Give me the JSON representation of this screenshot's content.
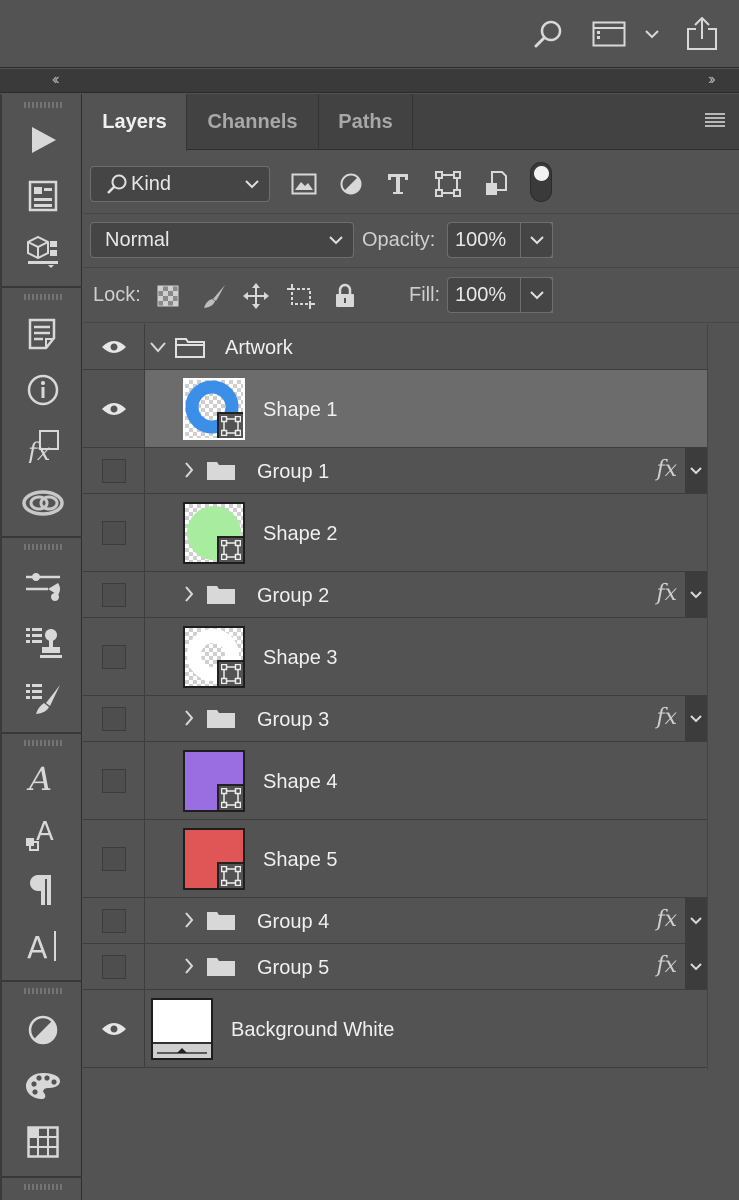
{
  "panel": {
    "tabs": [
      {
        "label": "Layers",
        "active": true
      },
      {
        "label": "Channels",
        "active": false
      },
      {
        "label": "Paths",
        "active": false
      }
    ],
    "filter": {
      "kind_label": "Kind"
    },
    "blend": {
      "mode": "Normal",
      "opacity_label": "Opacity:",
      "opacity_value": "100%"
    },
    "lock": {
      "label": "Lock:",
      "fill_label": "Fill:",
      "fill_value": "100%"
    }
  },
  "layers": [
    {
      "name": "Artwork",
      "type": "group-open",
      "visible": true
    },
    {
      "name": "Shape 1",
      "type": "shape",
      "visible": true,
      "selected": true,
      "color": "#3b8fe8",
      "shape": "ring"
    },
    {
      "name": "Group 1",
      "type": "group",
      "visible": false,
      "fx": "fx"
    },
    {
      "name": "Shape 2",
      "type": "shape",
      "visible": false,
      "color": "#a8ec9f",
      "shape": "pie"
    },
    {
      "name": "Group 2",
      "type": "group",
      "visible": false,
      "fx": "fx"
    },
    {
      "name": "Shape 3",
      "type": "shape",
      "visible": false,
      "color": "#ffffff",
      "shape": "ring"
    },
    {
      "name": "Group 3",
      "type": "group",
      "visible": false,
      "fx": "fx"
    },
    {
      "name": "Shape 4",
      "type": "shape",
      "visible": false,
      "color": "#9a6ee0",
      "shape": "square"
    },
    {
      "name": "Shape 5",
      "type": "shape",
      "visible": false,
      "color": "#e05656",
      "shape": "square"
    },
    {
      "name": "Group 4",
      "type": "group",
      "visible": false,
      "fx": "fx"
    },
    {
      "name": "Group 5",
      "type": "group",
      "visible": false,
      "fx": "fx"
    },
    {
      "name": "Background White",
      "type": "background",
      "visible": true
    }
  ]
}
